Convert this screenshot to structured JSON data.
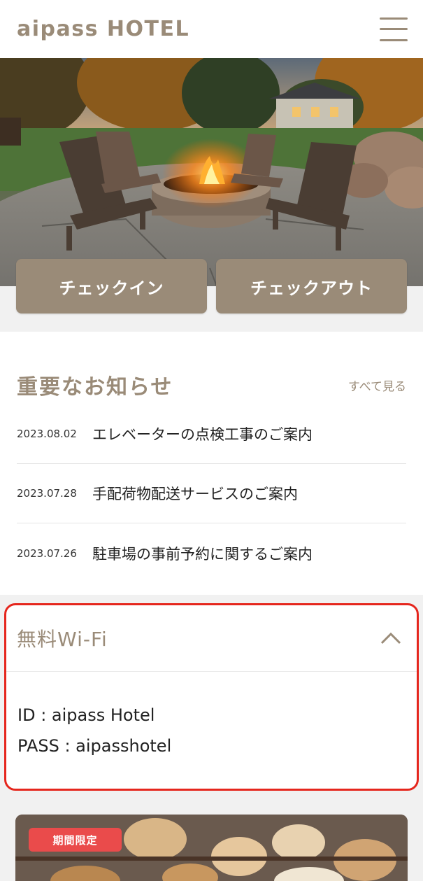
{
  "header": {
    "brand": "aipass HOTEL",
    "menu_icon": "hamburger-menu-icon"
  },
  "hero": {
    "image": "fire-pit-with-adirondack-chairs-photo"
  },
  "actions": {
    "checkin_label": "チェックイン",
    "checkout_label": "チェックアウト"
  },
  "news": {
    "title": "重要なお知らせ",
    "see_all": "すべて見る",
    "items": [
      {
        "date": "2023.08.02",
        "text": "エレベーターの点検工事のご案内"
      },
      {
        "date": "2023.07.28",
        "text": "手配荷物配送サービスのご案内"
      },
      {
        "date": "2023.07.26",
        "text": "駐車場の事前予約に関するご案内"
      }
    ]
  },
  "wifi": {
    "title": "無料Wi-Fi",
    "id_line": "ID : aipass Hotel",
    "pass_line": "PASS : aipasshotel",
    "toggle_icon": "chevron-up-icon"
  },
  "promo": {
    "badge": "期間限定",
    "image": "bakery-pastries-photo"
  },
  "colors": {
    "accent": "#9a8b78",
    "highlight_border": "#e5261d",
    "badge": "#ea4b4b",
    "background": "#f1f1f1"
  }
}
